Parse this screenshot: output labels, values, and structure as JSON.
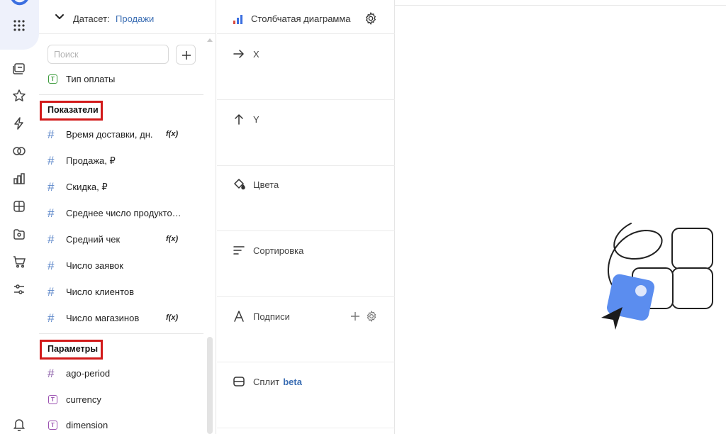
{
  "dataset": {
    "label": "Датасет:",
    "name": "Продажи",
    "search_placeholder": "Поиск",
    "top_fields": [
      {
        "name": "Тип оплаты",
        "type": "text"
      }
    ],
    "measures_title": "Показатели",
    "measures": [
      {
        "name": "Время доставки, дн.",
        "fx": "f(x)"
      },
      {
        "name": "Продажа, ₽",
        "fx": ""
      },
      {
        "name": "Скидка, ₽",
        "fx": ""
      },
      {
        "name": "Среднее число продукто…",
        "fx": ""
      },
      {
        "name": "Средний чек",
        "fx": "f(x)"
      },
      {
        "name": "Число заявок",
        "fx": ""
      },
      {
        "name": "Число клиентов",
        "fx": ""
      },
      {
        "name": "Число магазинов",
        "fx": "f(x)"
      }
    ],
    "params_title": "Параметры",
    "params": [
      {
        "name": "ago-period",
        "type": "number"
      },
      {
        "name": "currency",
        "type": "text"
      },
      {
        "name": "dimension",
        "type": "text"
      }
    ]
  },
  "chart_config": {
    "chart_type": "Столбчатая диаграмма",
    "slots": [
      {
        "label": "X",
        "icon": "arrow-right-icon"
      },
      {
        "label": "Y",
        "icon": "arrow-up-icon"
      },
      {
        "label": "Цвета",
        "icon": "paint-bucket-icon"
      },
      {
        "label": "Сортировка",
        "icon": "sort-icon"
      },
      {
        "label": "Подписи",
        "icon": "text-a-icon"
      },
      {
        "label": "Сплит",
        "badge": "beta",
        "icon": "split-icon"
      }
    ]
  },
  "colors": {
    "accent": "#3a6db3",
    "highlight_border": "#d21a1a",
    "illustration_blue": "#5b8def"
  }
}
